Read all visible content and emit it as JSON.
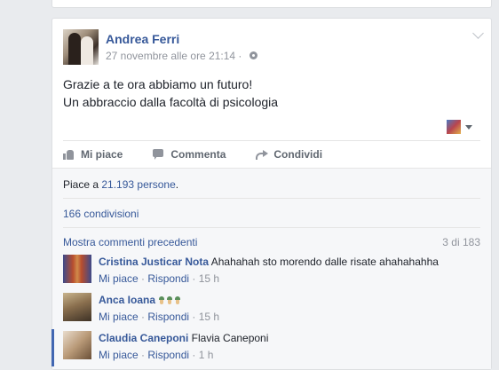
{
  "post": {
    "author": "Andrea Ferri",
    "timestamp": "27 novembre alle ore 21:14 ·",
    "privacy_icon": "globe-icon",
    "text_lines": [
      "Grazie a te ora abbiamo un futuro!",
      "Un abbraccio dalla facoltà di psicologia"
    ]
  },
  "actions": {
    "like": "Mi piace",
    "comment": "Commenta",
    "share": "Condividi"
  },
  "likes": {
    "prefix": "Piace a ",
    "count": "21.193 persone",
    "suffix": "."
  },
  "shares": "166 condivisioni",
  "comments_section": {
    "more_label": "Mostra commenti precedenti",
    "count": "3 di 183",
    "comments": [
      {
        "name": "Cristina Justicar Nota",
        "text": " Ahahahah sto morendo dalle risate ahahahahha",
        "like": "Mi piace",
        "reply": "Rispondi",
        "time": "15 h"
      },
      {
        "name": "Anca Ioana",
        "text": "",
        "like": "Mi piace",
        "reply": "Rispondi",
        "time": "15 h"
      },
      {
        "name": "Claudia Caneponi",
        "text": " Flavia Caneponi",
        "like": "Mi piace",
        "reply": "Rispondi",
        "time": "1 h"
      }
    ]
  },
  "colors": {
    "link": "#365899",
    "muted": "#90949c",
    "background": "#e9ebee"
  }
}
